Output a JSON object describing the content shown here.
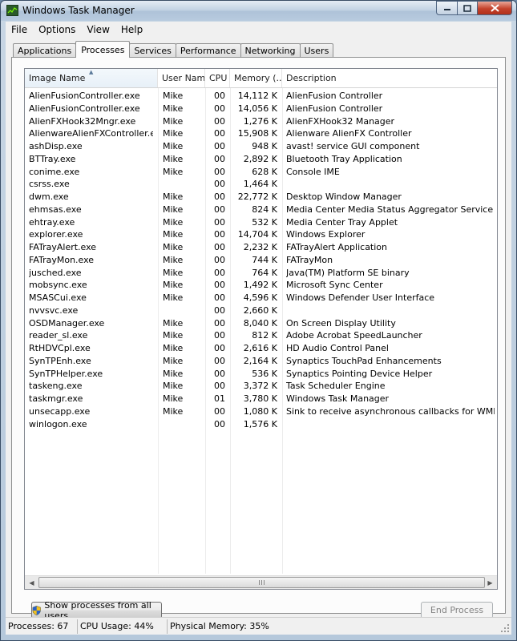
{
  "window": {
    "title": "Windows Task Manager"
  },
  "menu": [
    "File",
    "Options",
    "View",
    "Help"
  ],
  "tabs": [
    "Applications",
    "Processes",
    "Services",
    "Performance",
    "Networking",
    "Users"
  ],
  "active_tab": "Processes",
  "columns": {
    "image_name": "Image Name",
    "user_name": "User Name",
    "cpu": "CPU",
    "memory": "Memory (...",
    "description": "Description"
  },
  "processes": [
    {
      "image": "AlienFusionController.exe",
      "user": "Mike",
      "cpu": "00",
      "memory": "14,112 K",
      "description": "AlienFusion Controller"
    },
    {
      "image": "AlienFusionController.exe",
      "user": "Mike",
      "cpu": "00",
      "memory": "14,056 K",
      "description": "AlienFusion Controller"
    },
    {
      "image": "AlienFXHook32Mngr.exe",
      "user": "Mike",
      "cpu": "00",
      "memory": "1,276 K",
      "description": "AlienFXHook32 Manager"
    },
    {
      "image": "AlienwareAlienFXController.exe",
      "user": "Mike",
      "cpu": "00",
      "memory": "15,908 K",
      "description": "Alienware AlienFX Controller"
    },
    {
      "image": "ashDisp.exe",
      "user": "Mike",
      "cpu": "00",
      "memory": "948 K",
      "description": "avast! service GUI component"
    },
    {
      "image": "BTTray.exe",
      "user": "Mike",
      "cpu": "00",
      "memory": "2,892 K",
      "description": "Bluetooth Tray Application"
    },
    {
      "image": "conime.exe",
      "user": "Mike",
      "cpu": "00",
      "memory": "628 K",
      "description": "Console IME"
    },
    {
      "image": "csrss.exe",
      "user": "",
      "cpu": "00",
      "memory": "1,464 K",
      "description": ""
    },
    {
      "image": "dwm.exe",
      "user": "Mike",
      "cpu": "00",
      "memory": "22,772 K",
      "description": "Desktop Window Manager"
    },
    {
      "image": "ehmsas.exe",
      "user": "Mike",
      "cpu": "00",
      "memory": "824 K",
      "description": "Media Center Media Status Aggregator Service"
    },
    {
      "image": "ehtray.exe",
      "user": "Mike",
      "cpu": "00",
      "memory": "532 K",
      "description": "Media Center Tray Applet"
    },
    {
      "image": "explorer.exe",
      "user": "Mike",
      "cpu": "00",
      "memory": "14,704 K",
      "description": "Windows Explorer"
    },
    {
      "image": "FATrayAlert.exe",
      "user": "Mike",
      "cpu": "00",
      "memory": "2,232 K",
      "description": "FATrayAlert Application"
    },
    {
      "image": "FATrayMon.exe",
      "user": "Mike",
      "cpu": "00",
      "memory": "744 K",
      "description": "FATrayMon"
    },
    {
      "image": "jusched.exe",
      "user": "Mike",
      "cpu": "00",
      "memory": "764 K",
      "description": "Java(TM) Platform SE binary"
    },
    {
      "image": "mobsync.exe",
      "user": "Mike",
      "cpu": "00",
      "memory": "1,492 K",
      "description": "Microsoft Sync Center"
    },
    {
      "image": "MSASCui.exe",
      "user": "Mike",
      "cpu": "00",
      "memory": "4,596 K",
      "description": "Windows Defender User Interface"
    },
    {
      "image": "nvvsvc.exe",
      "user": "",
      "cpu": "00",
      "memory": "2,660 K",
      "description": ""
    },
    {
      "image": "OSDManager.exe",
      "user": "Mike",
      "cpu": "00",
      "memory": "8,040 K",
      "description": "On Screen Display Utility"
    },
    {
      "image": "reader_sl.exe",
      "user": "Mike",
      "cpu": "00",
      "memory": "812 K",
      "description": "Adobe Acrobat SpeedLauncher"
    },
    {
      "image": "RtHDVCpl.exe",
      "user": "Mike",
      "cpu": "00",
      "memory": "2,616 K",
      "description": "HD Audio Control Panel"
    },
    {
      "image": "SynTPEnh.exe",
      "user": "Mike",
      "cpu": "00",
      "memory": "2,164 K",
      "description": "Synaptics TouchPad Enhancements"
    },
    {
      "image": "SynTPHelper.exe",
      "user": "Mike",
      "cpu": "00",
      "memory": "536 K",
      "description": "Synaptics Pointing Device Helper"
    },
    {
      "image": "taskeng.exe",
      "user": "Mike",
      "cpu": "00",
      "memory": "3,372 K",
      "description": "Task Scheduler Engine"
    },
    {
      "image": "taskmgr.exe",
      "user": "Mike",
      "cpu": "01",
      "memory": "3,780 K",
      "description": "Windows Task Manager"
    },
    {
      "image": "unsecapp.exe",
      "user": "Mike",
      "cpu": "00",
      "memory": "1,080 K",
      "description": "Sink to receive asynchronous callbacks for WMI client app"
    },
    {
      "image": "winlogon.exe",
      "user": "",
      "cpu": "00",
      "memory": "1,576 K",
      "description": ""
    }
  ],
  "buttons": {
    "show_all": "Show processes from all users",
    "end_process": "End Process"
  },
  "status": {
    "processes": "Processes: 67",
    "cpu": "CPU Usage: 44%",
    "memory": "Physical Memory: 35%"
  },
  "icons": {
    "app": "task-manager-icon",
    "sort": "sort-ascending-icon",
    "shield": "uac-shield-icon"
  }
}
